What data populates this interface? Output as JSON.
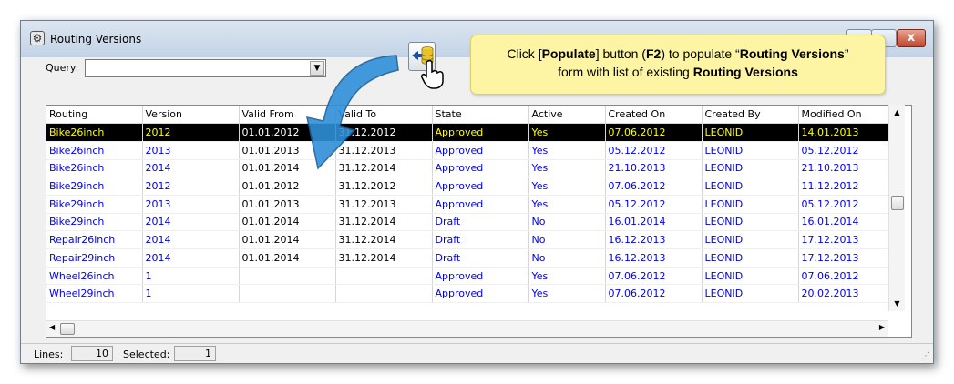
{
  "window": {
    "title": "Routing Versions",
    "close_label": "x"
  },
  "query": {
    "label": "Query:",
    "value": ""
  },
  "table": {
    "columns": [
      "Routing",
      "Version",
      "Valid From",
      "Valid To",
      "State",
      "Active",
      "Created On",
      "Created By",
      "Modified On"
    ],
    "rows": [
      [
        "Bike26inch",
        "2012",
        "01.01.2012",
        "31.12.2012",
        "Approved",
        "Yes",
        "07.06.2012",
        "LEONID",
        "14.01.2013"
      ],
      [
        "Bike26inch",
        "2013",
        "01.01.2013",
        "31.12.2013",
        "Approved",
        "Yes",
        "05.12.2012",
        "LEONID",
        "05.12.2012"
      ],
      [
        "Bike26inch",
        "2014",
        "01.01.2014",
        "31.12.2014",
        "Approved",
        "Yes",
        "21.10.2013",
        "LEONID",
        "21.10.2013"
      ],
      [
        "Bike29inch",
        "2012",
        "01.01.2012",
        "31.12.2012",
        "Approved",
        "Yes",
        "07.06.2012",
        "LEONID",
        "11.12.2012"
      ],
      [
        "Bike29inch",
        "2013",
        "01.01.2013",
        "31.12.2013",
        "Approved",
        "Yes",
        "05.12.2012",
        "LEONID",
        "05.12.2012"
      ],
      [
        "Bike29inch",
        "2014",
        "01.01.2014",
        "31.12.2014",
        "Draft",
        "No",
        "16.01.2014",
        "LEONID",
        "16.01.2014"
      ],
      [
        "Repair26inch",
        "2014",
        "01.01.2014",
        "31.12.2014",
        "Draft",
        "No",
        "16.12.2013",
        "LEONID",
        "17.12.2013"
      ],
      [
        "Repair29inch",
        "2014",
        "01.01.2014",
        "31.12.2014",
        "Draft",
        "No",
        "16.12.2013",
        "LEONID",
        "17.12.2013"
      ],
      [
        "Wheel26inch",
        "1",
        "",
        "",
        "Approved",
        "Yes",
        "07.06.2012",
        "LEONID",
        "07.06.2012"
      ],
      [
        "Wheel29inch",
        "1",
        "",
        "",
        "Approved",
        "Yes",
        "07.06.2012",
        "LEONID",
        "20.02.2013"
      ]
    ],
    "selected_row": 0
  },
  "status": {
    "lines_label": "Lines:",
    "lines_value": "10",
    "selected_label": "Selected:",
    "selected_value": "1"
  },
  "callout": {
    "text_1": "Click [",
    "bold_1": "Populate",
    "text_2": "] button (",
    "bold_2": "F2",
    "text_3": ") to populate “",
    "bold_3": "Routing Versions",
    "text_4": "”",
    "text_5": "form with list of existing ",
    "bold_4": "Routing Versions"
  },
  "colors": {
    "link_text": "#0000ee",
    "selected_bg": "#000000",
    "selected_text": "#ffff00",
    "callout_bg": "#fdf5a4",
    "arrow": "#2f8fd8"
  },
  "icons": {
    "window": "gear-icon",
    "populate": "populate-db-icon",
    "cursor": "hand-cursor-icon"
  }
}
